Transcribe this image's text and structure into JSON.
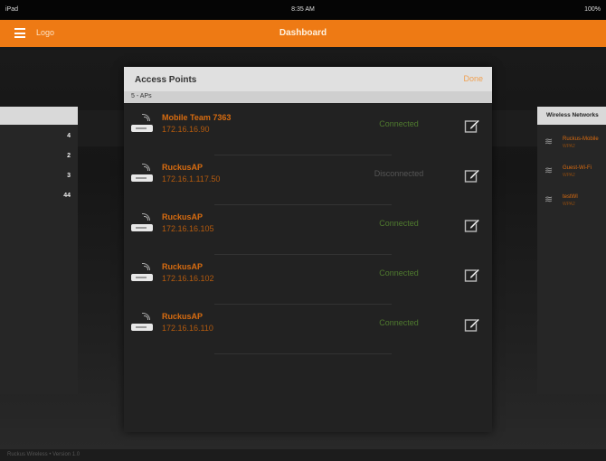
{
  "status_bar": {
    "left": "iPad",
    "time": "8:35 AM",
    "right": "100%"
  },
  "header": {
    "logo": "Logo",
    "title": "Dashboard"
  },
  "left_panel": {
    "counts": [
      "4",
      "2",
      "3",
      "44"
    ]
  },
  "right_panel": {
    "title": "Wireless Networks",
    "items": [
      {
        "name": "Ruckus-Mobile",
        "detail": "WPA2"
      },
      {
        "name": "Guest-Wi-Fi",
        "detail": "WPA2"
      },
      {
        "name": "testWl",
        "detail": "WPA2"
      }
    ]
  },
  "modal": {
    "title": "Access Points",
    "done_label": "Done",
    "count_label": "5 - APs",
    "access_points": [
      {
        "name": "Mobile Team 7363",
        "ip": "172.16.16.90",
        "status": "Connected",
        "connected": true
      },
      {
        "name": "RuckusAP",
        "ip": "172.16.1.117.50",
        "status": "Disconnected",
        "connected": false
      },
      {
        "name": "RuckusAP",
        "ip": "172.16.16.105",
        "status": "Connected",
        "connected": true
      },
      {
        "name": "RuckusAP",
        "ip": "172.16.16.102",
        "status": "Connected",
        "connected": true
      },
      {
        "name": "RuckusAP",
        "ip": "172.16.16.110",
        "status": "Connected",
        "connected": true
      }
    ]
  },
  "footer": {
    "text": "Ruckus Wireless • Version 1.0"
  },
  "colors": {
    "accent": "#ee7a14",
    "ap_name": "#d86c10",
    "connected": "#4f7a2e",
    "disconnected": "#555555"
  }
}
